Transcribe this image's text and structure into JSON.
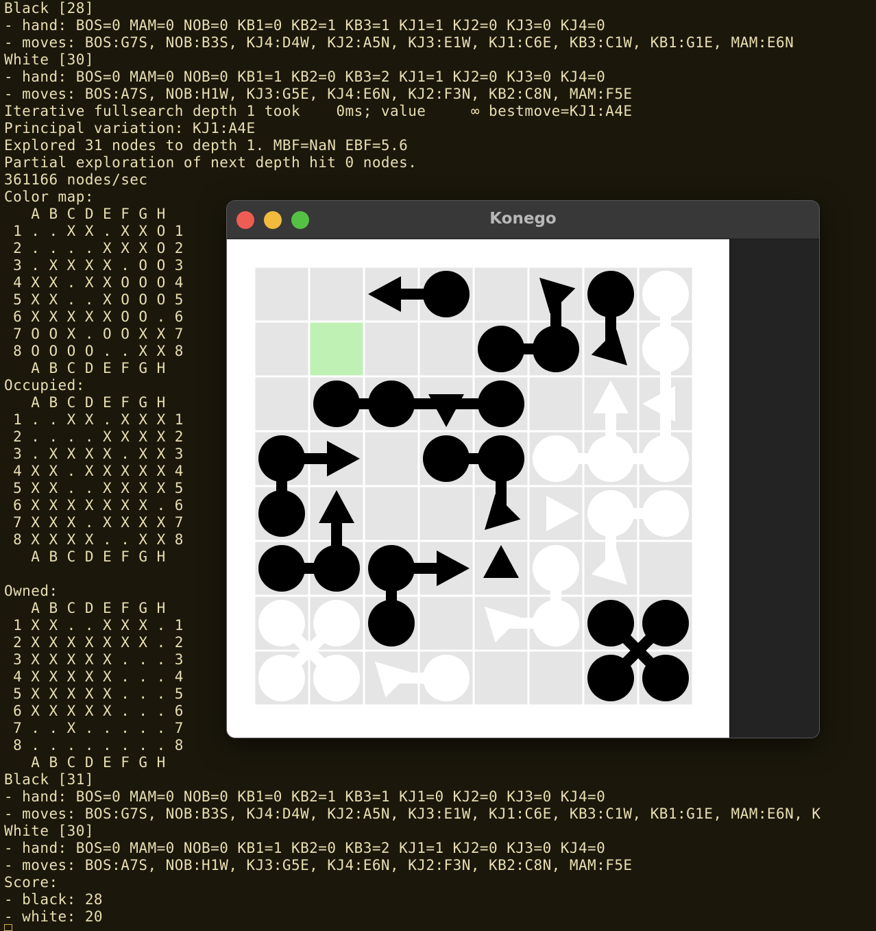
{
  "terminal": {
    "lines": [
      "Black [28]",
      "- hand: BOS=0 MAM=0 NOB=0 KB1=0 KB2=1 KB3=1 KJ1=1 KJ2=0 KJ3=0 KJ4=0",
      "- moves: BOS:G7S, NOB:B3S, KJ4:D4W, KJ2:A5N, KJ3:E1W, KJ1:C6E, KB3:C1W, KB1:G1E, MAM:E6N",
      "White [30]",
      "- hand: BOS=0 MAM=0 NOB=0 KB1=1 KB2=0 KB3=2 KJ1=1 KJ2=0 KJ3=0 KJ4=0",
      "- moves: BOS:A7S, NOB:H1W, KJ3:G5E, KJ4:E6N, KJ2:F3N, KB2:C8N, MAM:F5E",
      "Iterative fullsearch depth 1 took    0ms; value     ∞ bestmove=KJ1:A4E",
      "Principal variation: KJ1:A4E",
      "Explored 31 nodes to depth 1. MBF=NaN EBF=5.6",
      "Partial exploration of next depth hit 0 nodes.",
      "361166 nodes/sec",
      "Color map:",
      "   A B C D E F G H",
      " 1 . . X X . X X O 1",
      " 2 . . . . X X X O 2",
      " 3 . X X X X . O O 3",
      " 4 X X . X X O O O 4",
      " 5 X X . . X O O O 5",
      " 6 X X X X X O O . 6",
      " 7 O O X . O O X X 7",
      " 8 O O O O . . X X 8",
      "   A B C D E F G H",
      "Occupied:",
      "   A B C D E F G H",
      " 1 . . X X . X X X 1",
      " 2 . . . . X X X X 2",
      " 3 . X X X X . X X 3",
      " 4 X X . X X X X X 4",
      " 5 X X . . X X X X 5",
      " 6 X X X X X X X . 6",
      " 7 X X X . X X X X 7",
      " 8 X X X X . . X X 8",
      "   A B C D E F G H",
      "",
      "Owned:",
      "   A B C D E F G H",
      " 1 X X . . X X X . 1",
      " 2 X X X X X X X . 2",
      " 3 X X X X X . . . 3",
      " 4 X X X X X . . . 4",
      " 5 X X X X X . . . 5",
      " 6 X X X X X . . . 6",
      " 7 . . X . . . . . 7",
      " 8 . . . . . . . . 8",
      "   A B C D E F G H",
      "Black [31]",
      "- hand: BOS=0 MAM=0 NOB=0 KB1=0 KB2=1 KB3=1 KJ1=0 KJ2=0 KJ3=0 KJ4=0",
      "- moves: BOS:G7S, NOB:B3S, KJ4:D4W, KJ2:A5N, KJ3:E1W, KJ1:C6E, KB3:C1W, KB1:G1E, MAM:E6N, K",
      "White [30]",
      "- hand: BOS=0 MAM=0 NOB=0 KB1=1 KB2=0 KB3=2 KJ1=1 KJ2=0 KJ3=0 KJ4=0",
      "- moves: BOS:A7S, NOB:H1W, KJ3:G5E, KJ4:E6N, KJ2:F3N, KB2:C8N, MAM:F5E",
      "Score:",
      "- black: 28",
      "- white: 20"
    ]
  },
  "window": {
    "title": "Konego"
  },
  "board": {
    "columns": [
      "A",
      "B",
      "C",
      "D",
      "E",
      "F",
      "G",
      "H"
    ],
    "rows": [
      1,
      2,
      3,
      4,
      5,
      6,
      7,
      8
    ],
    "highlight_cell": "B2",
    "colors": {
      "cell": "#e5e5e5",
      "grid_line": "#ffffff",
      "highlight": "#bff0b4",
      "black": "#000000",
      "white": "#ffffff"
    },
    "discs": [
      {
        "color": "black",
        "cells": [
          "D1",
          "G1",
          "E2",
          "F2",
          "B3",
          "C3",
          "E3",
          "A4",
          "D4",
          "E4",
          "A5",
          "A6",
          "B6",
          "C6",
          "C7",
          "G7",
          "H7",
          "G8",
          "H8"
        ]
      },
      {
        "color": "white",
        "cells": [
          "H1",
          "H2",
          "F4",
          "G4",
          "H4",
          "G5",
          "H5",
          "F6",
          "F7",
          "A7",
          "B7",
          "A8",
          "B8",
          "D8"
        ]
      }
    ],
    "connectors": [
      {
        "color": "black",
        "pairs": [
          [
            "D1",
            "C1"
          ],
          [
            "G1",
            "G2"
          ],
          [
            "E2",
            "F2"
          ],
          [
            "F2",
            "F1"
          ],
          [
            "B3",
            "C3"
          ],
          [
            "C3",
            "E3"
          ],
          [
            "A4",
            "B4"
          ],
          [
            "A4",
            "A5"
          ],
          [
            "D4",
            "E4"
          ],
          [
            "E4",
            "E5"
          ],
          [
            "A6",
            "B6"
          ],
          [
            "B6",
            "B5"
          ],
          [
            "C6",
            "D6"
          ],
          [
            "C6",
            "C7"
          ],
          [
            "G7",
            "H8"
          ],
          [
            "H7",
            "G8"
          ]
        ]
      },
      {
        "color": "white",
        "pairs": [
          [
            "H1",
            "H2"
          ],
          [
            "H2",
            "H3"
          ],
          [
            "G3",
            "G4"
          ],
          [
            "F4",
            "G4"
          ],
          [
            "G4",
            "H4"
          ],
          [
            "H4",
            "H3"
          ],
          [
            "G5",
            "H5"
          ],
          [
            "G5",
            "G6"
          ],
          [
            "F6",
            "F7"
          ],
          [
            "E7",
            "F7"
          ],
          [
            "A7",
            "B8"
          ],
          [
            "B7",
            "A8"
          ],
          [
            "C8",
            "D8"
          ]
        ]
      }
    ],
    "arrows": [
      {
        "color": "black",
        "cell": "C1",
        "dir": "W"
      },
      {
        "color": "black",
        "cell": "F1",
        "dir": "NW"
      },
      {
        "color": "black",
        "cell": "G2",
        "dir": "SE"
      },
      {
        "color": "black",
        "cell": "D3",
        "dir": "S"
      },
      {
        "color": "black",
        "cell": "B4",
        "dir": "E"
      },
      {
        "color": "black",
        "cell": "E5",
        "dir": "SW"
      },
      {
        "color": "black",
        "cell": "B5",
        "dir": "N"
      },
      {
        "color": "black",
        "cell": "D6",
        "dir": "E"
      },
      {
        "color": "black",
        "cell": "E6",
        "dir": "N"
      },
      {
        "color": "white",
        "cell": "G3",
        "dir": "N"
      },
      {
        "color": "white",
        "cell": "H3",
        "dir": "W"
      },
      {
        "color": "white",
        "cell": "F5",
        "dir": "E"
      },
      {
        "color": "white",
        "cell": "G6",
        "dir": "SE"
      },
      {
        "color": "white",
        "cell": "E7",
        "dir": "NW"
      },
      {
        "color": "white",
        "cell": "C8",
        "dir": "NW"
      }
    ]
  }
}
